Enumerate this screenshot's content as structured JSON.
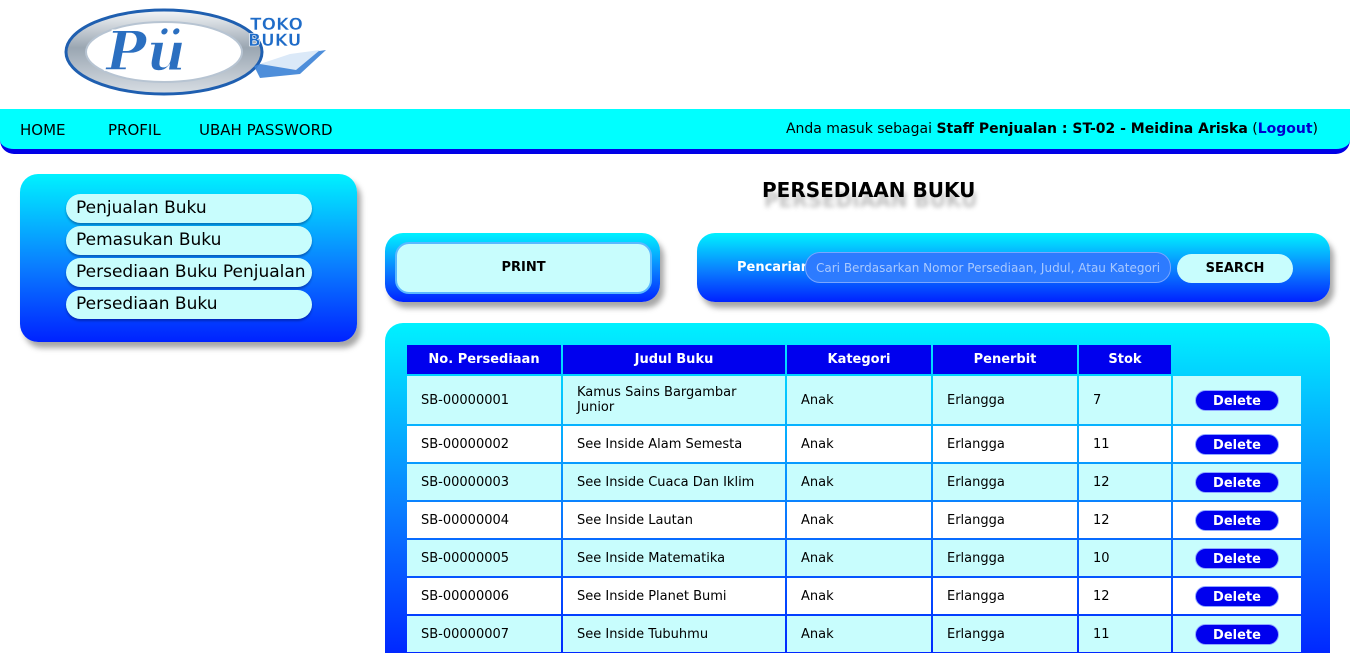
{
  "logo": {
    "text_top": "TOKO",
    "text_bottom": "BUKU",
    "monogram": "Pü"
  },
  "nav": {
    "home": "HOME",
    "profil": "PROFIL",
    "ubah_password": "UBAH PASSWORD",
    "user_prefix": "Anda masuk sebagai",
    "user_role": "Staff Penjualan : ST-02 - Meidina Ariska",
    "logout": "Logout"
  },
  "sidebar": {
    "items": [
      {
        "label": "Penjualan Buku"
      },
      {
        "label": "Pemasukan Buku"
      },
      {
        "label": "Persediaan Buku Penjualan"
      },
      {
        "label": "Persediaan Buku"
      }
    ]
  },
  "page_title": "PERSEDIAAN BUKU",
  "print": {
    "label": "PRINT"
  },
  "search": {
    "label": "Pencarian",
    "placeholder": "Cari Berdasarkan Nomor Persediaan, Judul, Atau Kategori",
    "button": "SEARCH"
  },
  "table": {
    "headers": [
      "No. Persediaan",
      "Judul Buku",
      "Kategori",
      "Penerbit",
      "Stok"
    ],
    "delete_label": "Delete",
    "rows": [
      {
        "no": "SB-00000001",
        "judul": "Kamus Sains Bargambar Junior",
        "kategori": "Anak",
        "penerbit": "Erlangga",
        "stok": "7"
      },
      {
        "no": "SB-00000002",
        "judul": "See Inside Alam Semesta",
        "kategori": "Anak",
        "penerbit": "Erlangga",
        "stok": "11"
      },
      {
        "no": "SB-00000003",
        "judul": "See Inside Cuaca Dan Iklim",
        "kategori": "Anak",
        "penerbit": "Erlangga",
        "stok": "12"
      },
      {
        "no": "SB-00000004",
        "judul": "See Inside Lautan",
        "kategori": "Anak",
        "penerbit": "Erlangga",
        "stok": "12"
      },
      {
        "no": "SB-00000005",
        "judul": "See Inside Matematika",
        "kategori": "Anak",
        "penerbit": "Erlangga",
        "stok": "10"
      },
      {
        "no": "SB-00000006",
        "judul": "See Inside Planet Bumi",
        "kategori": "Anak",
        "penerbit": "Erlangga",
        "stok": "12"
      },
      {
        "no": "SB-00000007",
        "judul": "See Inside Tubuhmu",
        "kategori": "Anak",
        "penerbit": "Erlangga",
        "stok": "11"
      }
    ]
  }
}
